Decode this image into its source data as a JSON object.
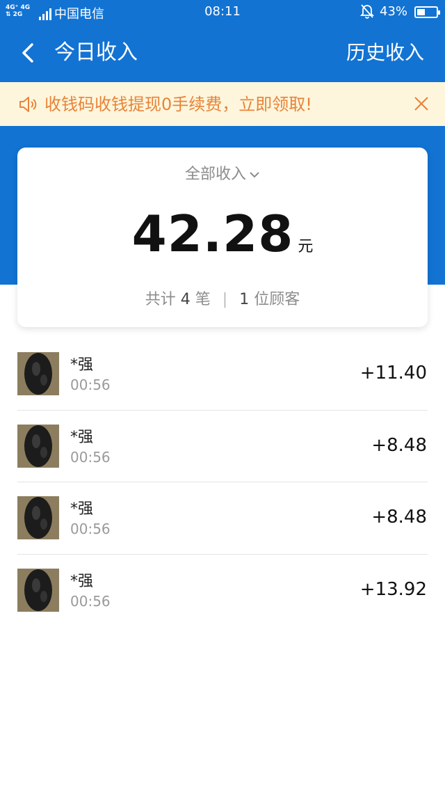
{
  "status_bar": {
    "network_top": "4G⁺ 4G",
    "network_bottom": "⇅ 2G",
    "carrier": "中国电信",
    "time": "08:11",
    "battery": "43%",
    "battery_level": 0.43
  },
  "header": {
    "title": "今日收入",
    "history_label": "历史收入"
  },
  "notice": {
    "text": "收钱码收钱提现0手续费，立即领取!",
    "color": "#e8833a"
  },
  "summary": {
    "filter_label": "全部收入",
    "total": "42.28",
    "unit": "元",
    "count_prefix": "共计",
    "count": "4",
    "count_suffix": "笔",
    "separator": "|",
    "customers": "1",
    "customers_suffix": "位顾客"
  },
  "transactions": [
    {
      "name": "*强",
      "time": "00:56",
      "amount": "+11.40"
    },
    {
      "name": "*强",
      "time": "00:56",
      "amount": "+8.48"
    },
    {
      "name": "*强",
      "time": "00:56",
      "amount": "+8.48"
    },
    {
      "name": "*强",
      "time": "00:56",
      "amount": "+13.92"
    }
  ],
  "colors": {
    "primary": "#1273d3",
    "notice_bg": "#fdf6dc"
  }
}
